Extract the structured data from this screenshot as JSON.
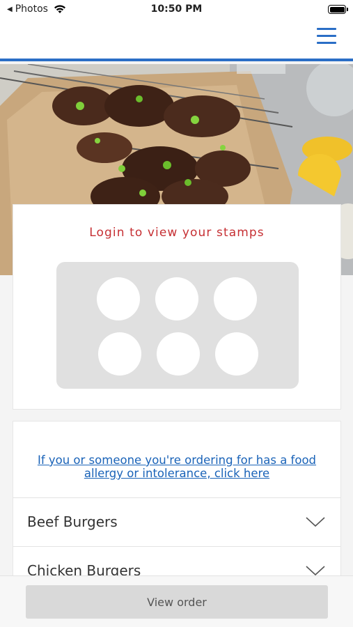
{
  "status_bar": {
    "back_app": "Photos",
    "time": "10:50 PM"
  },
  "header": {
    "menu_icon": "hamburger-menu-icon",
    "accent_color": "#2a6ec6"
  },
  "hero": {
    "description_icon": "food-photo"
  },
  "stamps": {
    "title": "Login to view your stamps",
    "title_color": "#c62f33",
    "stamp_count": 6,
    "collected": 0
  },
  "menu": {
    "allergy_link": "If you or someone you're ordering for has a food allergy or intolerance, click here",
    "categories": [
      {
        "label": "Beef Burgers",
        "icon": "chevron-down-icon"
      },
      {
        "label": "Chicken Burgers",
        "icon": "chevron-down-icon"
      }
    ]
  },
  "footer": {
    "view_order_label": "View order"
  }
}
